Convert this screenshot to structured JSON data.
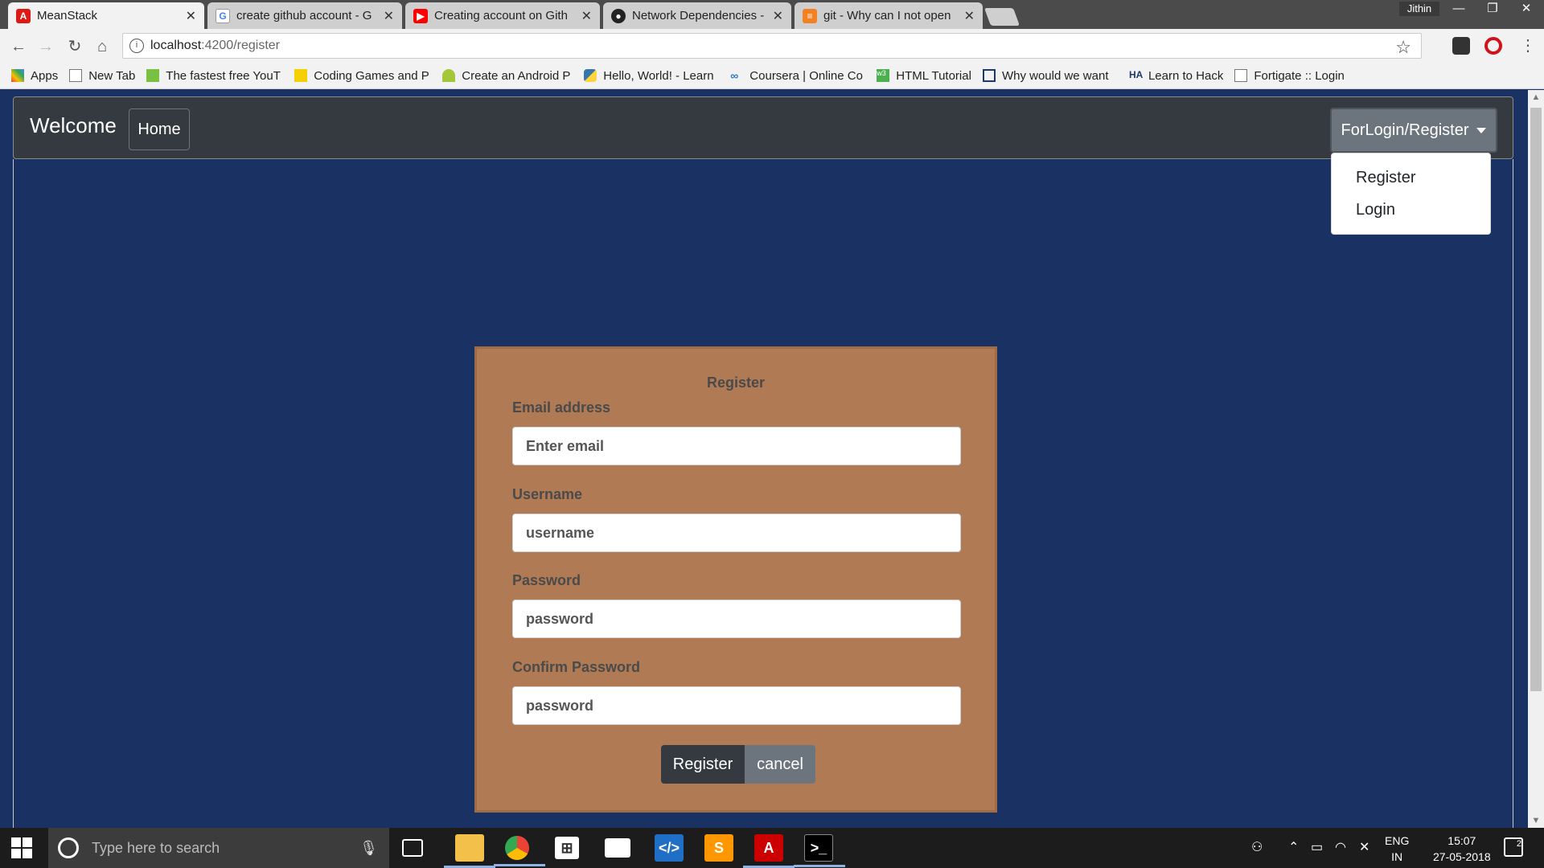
{
  "browser": {
    "tabs": [
      {
        "title": "MeanStack",
        "icon": "angular-icon",
        "color": "#dd1b16"
      },
      {
        "title": "create github account - G",
        "icon": "google-icon",
        "color": "#4285f4"
      },
      {
        "title": "Creating account on Gith",
        "icon": "youtube-icon",
        "color": "#ff0000"
      },
      {
        "title": "Network Dependencies - ",
        "icon": "github-icon",
        "color": "#222222"
      },
      {
        "title": "git - Why can I not open",
        "icon": "stackoverflow-icon",
        "color": "#f48024"
      }
    ],
    "user": "Jithin",
    "url_host": "localhost",
    "url_path": ":4200/register",
    "bookmarks": [
      {
        "label": "Apps"
      },
      {
        "label": "New Tab"
      },
      {
        "label": "The fastest free YouT"
      },
      {
        "label": "Coding Games and P"
      },
      {
        "label": "Create an Android P"
      },
      {
        "label": "Hello, World! - Learn"
      },
      {
        "label": "Coursera | Online Co"
      },
      {
        "label": "HTML Tutorial"
      },
      {
        "label": "Why would we want"
      },
      {
        "label": "Learn to Hack"
      },
      {
        "label": "Fortigate :: Login"
      }
    ]
  },
  "navbar": {
    "brand": "Welcome",
    "home": "Home",
    "dropdown_label": "ForLogin/Register",
    "dropdown_items": [
      "Register",
      "Login"
    ]
  },
  "register_form": {
    "title": "Register",
    "email_label": "Email address",
    "email_placeholder": "Enter email",
    "username_label": "Username",
    "username_placeholder": "username",
    "password_label": "Password",
    "password_placeholder": "password",
    "confirm_label": "Confirm Password",
    "confirm_placeholder": "password",
    "register_button": "Register",
    "cancel_button": "cancel"
  },
  "taskbar": {
    "search_placeholder": "Type here to search",
    "lang_top": "ENG",
    "lang_bottom": "IN",
    "time": "15:07",
    "date": "27-05-2018",
    "notifications": "2"
  },
  "colors": {
    "page_bg": "#1a3163",
    "navbar_bg": "#343a40",
    "card_bg": "#b07a55"
  }
}
